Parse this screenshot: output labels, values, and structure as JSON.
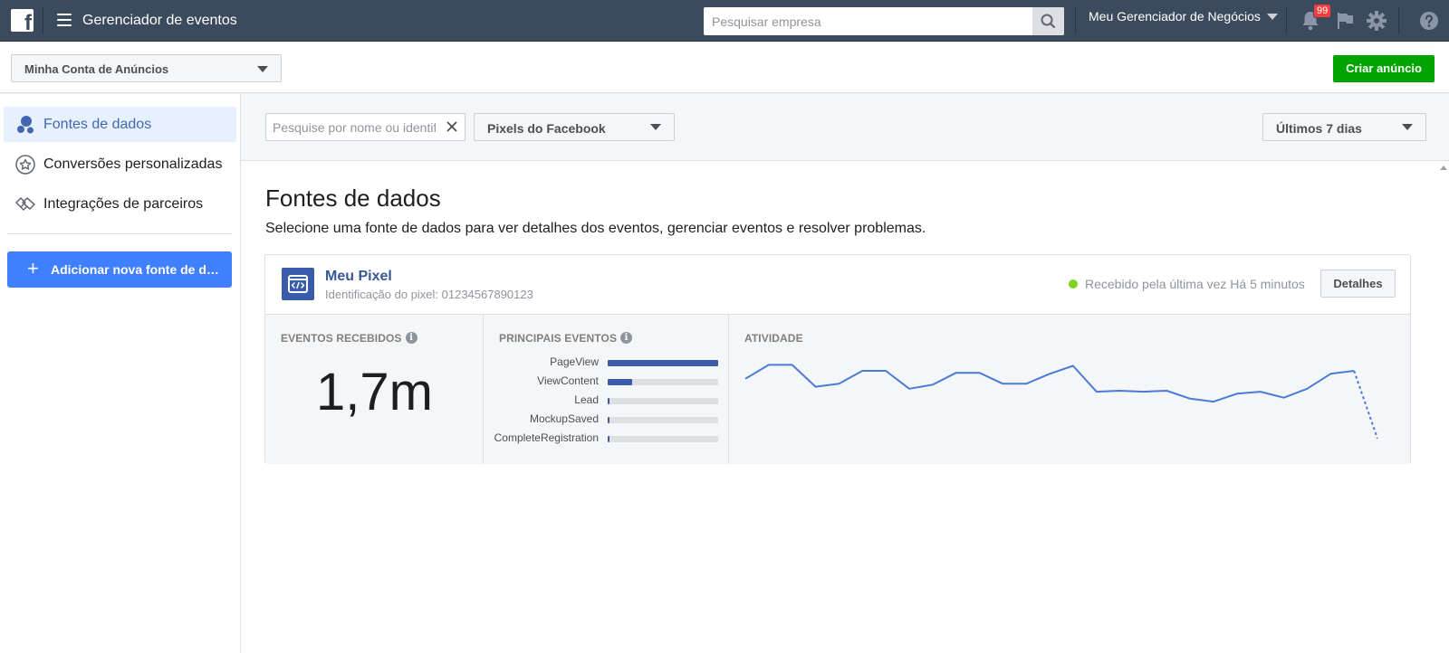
{
  "topbar": {
    "app_title": "Gerenciador de eventos",
    "search_placeholder": "Pesquisar empresa",
    "business_menu": "Meu Gerenciador de Negócios",
    "notifications_count": "99",
    "icons": [
      "facebook-logo",
      "hamburger-menu",
      "search-icon",
      "bell-icon",
      "flag-icon",
      "gear-icon",
      "help-icon"
    ]
  },
  "subbar": {
    "account_select": "Minha Conta de Anúncios",
    "create_button": "Criar anúncio"
  },
  "sidebar": {
    "items": [
      {
        "label": "Fontes de dados",
        "active": true,
        "icon": "data-sources-icon"
      },
      {
        "label": "Conversões personalizadas",
        "active": false,
        "icon": "star-badge-icon"
      },
      {
        "label": "Integrações de parceiros",
        "active": false,
        "icon": "handshake-icon"
      }
    ],
    "add_button": "Adicionar nova fonte de d…"
  },
  "filters": {
    "search_placeholder": "Pesquise por nome ou identificação",
    "source_type": "Pixels do Facebook",
    "date_range": "Últimos 7 dias"
  },
  "main": {
    "title": "Fontes de dados",
    "subtitle": "Selecione uma fonte de dados para ver detalhes dos eventos, gerenciar eventos e resolver problemas.",
    "pixel": {
      "name": "Meu Pixel",
      "id_text": "Identificação do pixel: 01234567890123",
      "status": "Recebido pela última vez Há 5 minutos",
      "status_color": "#7ed321",
      "details_button": "Detalhes"
    },
    "stats": {
      "events_label": "EVENTOS RECEBIDOS",
      "events_value": "1,7m",
      "top_events_label": "PRINCIPAIS EVENTOS",
      "top_events": [
        {
          "name": "PageView",
          "fraction": 1.0
        },
        {
          "name": "ViewContent",
          "fraction": 0.22
        },
        {
          "name": "Lead",
          "fraction": 0.02
        },
        {
          "name": "MockupSaved",
          "fraction": 0.02
        },
        {
          "name": "CompleteRegistration",
          "fraction": 0.02
        }
      ],
      "activity_label": "ATIVIDADE"
    }
  },
  "chart_data": {
    "type": "line",
    "title": "ATIVIDADE",
    "series": [
      {
        "values": [
          72,
          86,
          86,
          64,
          67,
          80,
          80,
          62,
          66,
          78,
          78,
          67,
          67,
          77,
          85,
          59,
          60,
          59,
          60,
          52,
          49,
          57,
          59,
          53,
          62,
          77,
          80,
          12
        ],
        "dashed_last_segment": true
      }
    ],
    "ylim": [
      0,
      100
    ],
    "grid": false,
    "color": "#4a7bd8"
  }
}
